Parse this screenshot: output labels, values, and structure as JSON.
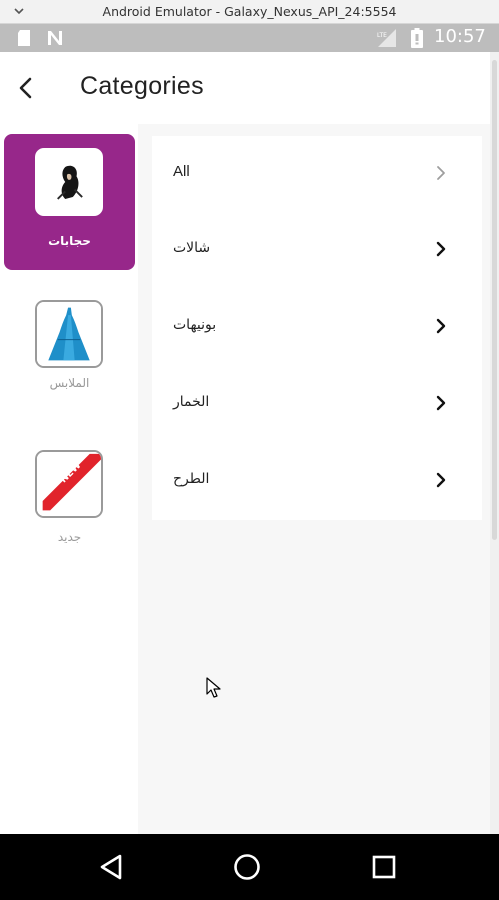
{
  "window": {
    "title": "Android Emulator - Galaxy_Nexus_API_24:5554"
  },
  "status_bar": {
    "time": "10:57",
    "icons": [
      "sd-card-icon",
      "n-notification-icon",
      "lte-signal-icon",
      "battery-icon"
    ]
  },
  "toolbar": {
    "title": "Categories",
    "back_icon": "chevron-left-icon"
  },
  "categories": [
    {
      "label": "حجابات",
      "selected": true,
      "icon": "hijab-thumbnail"
    },
    {
      "label": "الملابس",
      "selected": false,
      "icon": "dress-thumbnail"
    },
    {
      "label": "جديد",
      "selected": false,
      "icon": "new-ribbon-thumbnail"
    }
  ],
  "subcategories": [
    {
      "label": "All",
      "emphasis": "light"
    },
    {
      "label": "شالات",
      "emphasis": "dark"
    },
    {
      "label": "بونيهات",
      "emphasis": "dark"
    },
    {
      "label": "الخمار",
      "emphasis": "dark"
    },
    {
      "label": "الطرح",
      "emphasis": "dark"
    }
  ],
  "new_badge": "NEW",
  "colors": {
    "accent": "#97278a",
    "status_bar": "#bdbdbd",
    "nav_bar": "#000000",
    "content_bg": "#f7f7f7"
  },
  "navigation": [
    "back-triangle-icon",
    "home-circle-icon",
    "recents-square-icon"
  ]
}
